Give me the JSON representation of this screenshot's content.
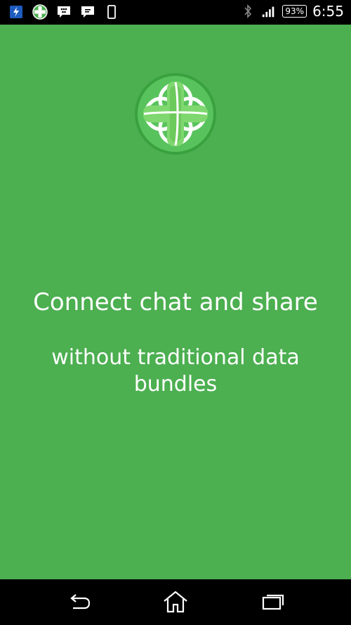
{
  "status_bar": {
    "notification_icons": [
      "flash-icon",
      "app-logo-icon",
      "bbm-icon",
      "chat-icon",
      "phone-icon"
    ],
    "right_icons": [
      "bluetooth-icon",
      "signal-icon"
    ],
    "battery": "93%",
    "time": "6:55"
  },
  "main": {
    "background": "#4caf50",
    "headline": "Connect chat and share",
    "subline": "without traditional data bundles"
  },
  "nav_bar": {
    "buttons": [
      "back-icon",
      "home-icon",
      "recents-icon"
    ]
  }
}
